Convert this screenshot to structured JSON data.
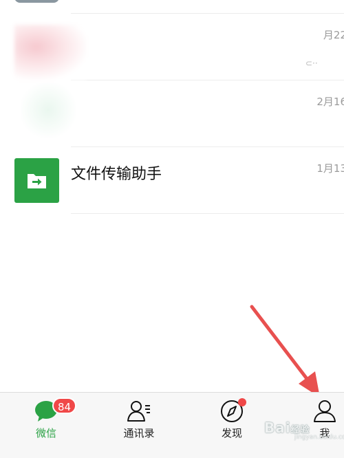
{
  "chat_list": [
    {
      "name": "",
      "time": "月22",
      "preview": "⊂··"
    },
    {
      "name": "",
      "time": "2月16"
    },
    {
      "name": "文件传输助手",
      "time": "1月13"
    }
  ],
  "tabbar": {
    "tabs": [
      {
        "label": "微信",
        "active": true,
        "badge": "84",
        "icon": "chat-bubble-icon"
      },
      {
        "label": "通讯录",
        "active": false,
        "icon": "contacts-icon"
      },
      {
        "label": "发现",
        "active": false,
        "icon": "compass-icon"
      },
      {
        "label": "我",
        "active": false,
        "icon": "person-icon"
      }
    ]
  },
  "colors": {
    "accent": "#2BA245",
    "badge": "#F04848",
    "annotation_arrow": "#E8504F"
  },
  "watermark": {
    "text": "Bai",
    "suffix": "经验",
    "sub": "jingyan.baidu.com"
  }
}
